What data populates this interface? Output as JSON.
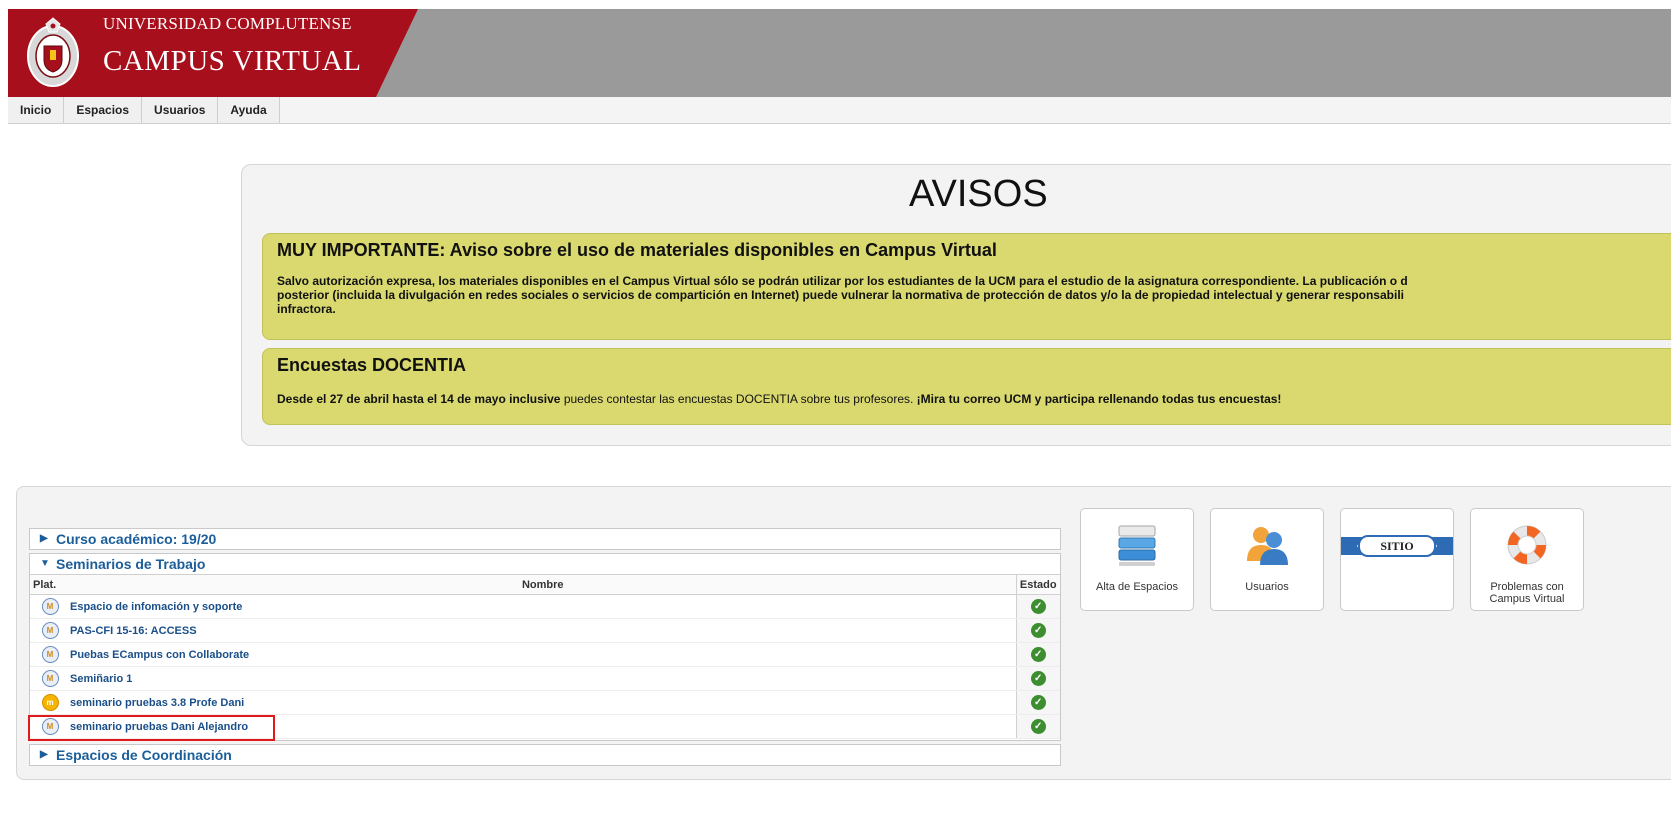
{
  "header": {
    "line1": "UNIVERSIDAD COMPLUTENSE",
    "line2": "CAMPUS VIRTUAL"
  },
  "menu": [
    "Inicio",
    "Espacios",
    "Usuarios",
    "Ayuda"
  ],
  "notices": {
    "title": "AVISOS",
    "items": [
      {
        "heading": "MUY IMPORTANTE: Aviso sobre el uso de materiales disponibles en Campus Virtual",
        "body_line1": "Salvo autorización expresa, los materiales disponibles en el Campus Virtual sólo se podrán utilizar por los estudiantes de la UCM para el estudio de la asignatura correspondiente. La publicación o d",
        "body_line2": "posterior (incluida la divulgación en redes sociales o servicios de compartición en Internet) puede vulnerar la normativa de protección de datos y/o la de propiedad intelectual y generar responsabili",
        "body_line3": "infractora."
      },
      {
        "heading": "Encuestas DOCENTIA",
        "body_bold1": "Desde el 27 de abril hasta el 14 de mayo inclusive",
        "body_normal": " puedes contestar las encuestas DOCENTIA sobre tus profesores. ",
        "body_bold2": "¡Mira tu correo UCM y participa rellenando todas tus encuestas!"
      }
    ]
  },
  "spaces": {
    "sections": [
      {
        "label": "Curso académico: 19/20",
        "expanded": false
      },
      {
        "label": "Seminarios de Trabajo",
        "expanded": true
      },
      {
        "label": "Espacios de Coordinación",
        "expanded": false
      }
    ],
    "columns": {
      "plat": "Plat.",
      "nombre": "Nombre",
      "estado": "Estado"
    },
    "rows": [
      {
        "name": "Espacio de infomación y soporte",
        "platform": "blue"
      },
      {
        "name": "PAS-CFI 15-16: ACCESS",
        "platform": "blue"
      },
      {
        "name": "Puebas ECampus con Collaborate",
        "platform": "blue"
      },
      {
        "name": "Semiñario 1",
        "platform": "blue"
      },
      {
        "name": "seminario pruebas 3.8 Profe Dani",
        "platform": "orange"
      },
      {
        "name": "seminario pruebas Dani Alejandro",
        "platform": "blue"
      }
    ]
  },
  "tiles": [
    {
      "label": "Alta de Espacios",
      "icon": "server-stack-icon"
    },
    {
      "label": "Usuarios",
      "icon": "users-icon"
    },
    {
      "label": "",
      "icon": "sitio-banner-icon",
      "banner_text": "SITIO"
    },
    {
      "label_line1": "Problemas con",
      "label_line2": "Campus Virtual",
      "icon": "lifebuoy-icon"
    }
  ],
  "colors": {
    "brand_red": "#a80f1c",
    "header_gray": "#9a9a9a",
    "notice_yellow": "#d9d96f",
    "link_blue": "#1b4f8a",
    "status_green": "#3d8e2f",
    "highlight_red": "#e01a1a"
  }
}
